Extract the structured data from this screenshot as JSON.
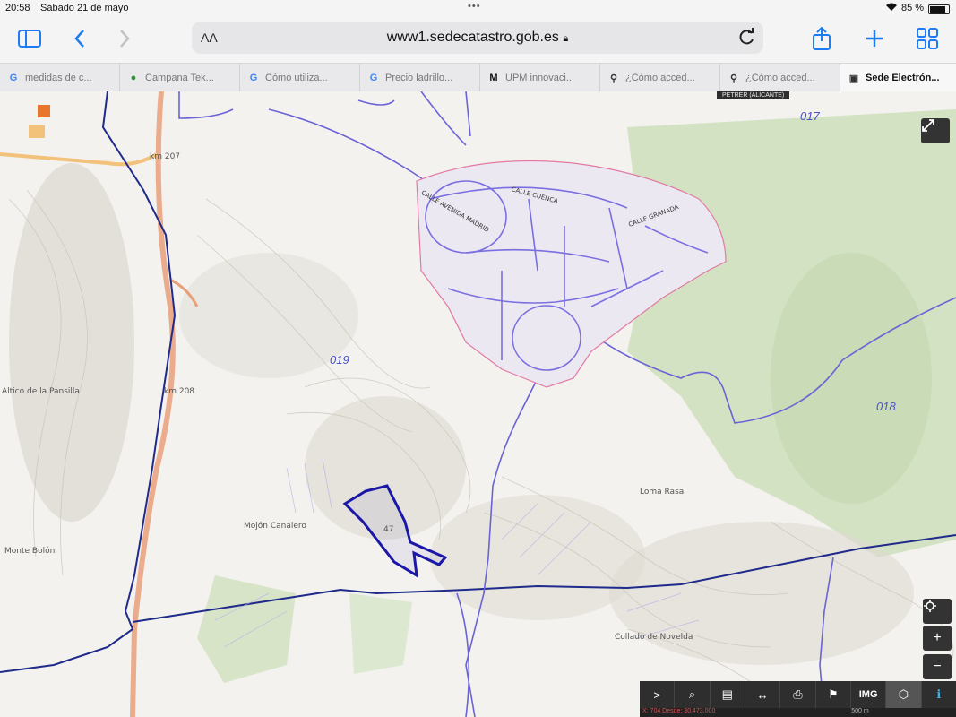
{
  "status_bar": {
    "time": "20:58",
    "date": "Sábado 21 de mayo",
    "battery": "85 %",
    "battery_level": 0.85
  },
  "toolbar": {
    "text_size_label": "AA",
    "url": "www1.sedecatastro.gob.es",
    "icons": [
      "sidebar-icon",
      "back-icon",
      "forward-icon",
      "lock-icon",
      "reload-icon",
      "share-icon",
      "new-tab-icon",
      "tabs-overview-icon"
    ]
  },
  "tabs": [
    {
      "label": "medidas de c...",
      "icon": "G"
    },
    {
      "label": "Campana Tek...",
      "icon": "●"
    },
    {
      "label": "Cómo utiliza...",
      "icon": "G"
    },
    {
      "label": "Precio ladrillo...",
      "icon": "G"
    },
    {
      "label": "UPM innovaci...",
      "icon": "M"
    },
    {
      "label": "¿Cómo acced...",
      "icon": "⚲"
    },
    {
      "label": "¿Cómo acced...",
      "icon": "⚲"
    },
    {
      "label": "Sede Electrón...",
      "icon": "▣",
      "active": true
    }
  ],
  "map": {
    "zone_tag": "PETRER (ALICANTE)",
    "polygon_ids": {
      "p017": "017",
      "p018": "018",
      "p019": "019"
    },
    "parcel_number": "47",
    "labels": {
      "km207": "km 207",
      "km208": "km 208",
      "altico": "Altico de la Pansilla",
      "monte_bolon": "Monte Bolón",
      "mojon": "Mojón Canalero",
      "loma_rasa": "Loma Rasa",
      "collado": "Collado de Novelda"
    },
    "street_labels": [
      "CALLE AVENIDA MADRID",
      "CALLE CUENCA",
      "CALLE GRANADA"
    ],
    "coords_text": "X: 704 Desde: 30.473,000",
    "scale_text": "500 m",
    "colors": {
      "parcel_line": "#6b63d6",
      "urban_line": "#e27aa3",
      "selected_parcel": "#1b18a8",
      "boundary": "#1f2a8a",
      "highway": "#e8a07a",
      "forest": "#cfe0be"
    }
  },
  "controls": {
    "expand_icon": "expand-icon",
    "locate_icon": "locate-icon",
    "zoom_in": "+",
    "zoom_out": "−",
    "bottom_toolbar": [
      ">",
      "⌕",
      "▤",
      "↔",
      "⎙",
      "⚑",
      "IMG",
      "⬡",
      "ℹ"
    ]
  }
}
